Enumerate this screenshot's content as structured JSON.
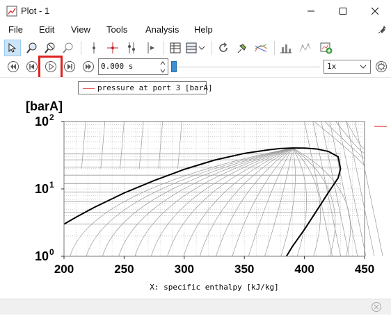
{
  "window": {
    "title": "Plot - 1"
  },
  "menu": [
    "File",
    "Edit",
    "View",
    "Tools",
    "Analysis",
    "Help"
  ],
  "toolbar": {
    "icons": [
      "pointer-icon",
      "zoom-icon",
      "zoom-out-icon",
      "zoom-reset-icon",
      "cursor-icon",
      "crosshair-icon",
      "cursors-icon",
      "cursor-step-icon",
      "table-icon",
      "refresh-icon",
      "pin-icon",
      "curves-icon",
      "bars-icon",
      "dots-icon",
      "add-plot-icon"
    ]
  },
  "playback": {
    "time": "0.000 s",
    "speed": "1x"
  },
  "legend": {
    "entry": "pressure at port 3 [barA]",
    "color": "#e46060"
  },
  "plot": {
    "y_unit": "[barA]",
    "y_ticks": [
      {
        "base": "10",
        "exp": "0"
      },
      {
        "base": "10",
        "exp": "1"
      },
      {
        "base": "10",
        "exp": "2"
      }
    ],
    "x_ticks": [
      "200",
      "250",
      "300",
      "350",
      "400",
      "450"
    ],
    "x_label": "X: specific enthalpy [kJ/kg]"
  },
  "chart_data": {
    "type": "line",
    "title": "",
    "xlabel": "X: specific enthalpy [kJ/kg]",
    "ylabel": "[barA]",
    "xlim": [
      200,
      450
    ],
    "ylim": [
      1,
      100
    ],
    "y_scale": "log",
    "grid": true,
    "series": [
      {
        "name": "",
        "role": "saturation dome",
        "color": "#000000",
        "x": [
          200,
          210,
          225,
          250,
          275,
          300,
          325,
          350,
          370,
          380,
          390,
          400,
          410,
          420,
          428,
          430,
          428,
          420,
          410,
          400,
          390,
          385
        ],
        "y": [
          3.0,
          3.8,
          5.3,
          8.7,
          13.3,
          19.5,
          26.7,
          33.7,
          38.0,
          39.8,
          40.5,
          40.3,
          39.2,
          36.0,
          30.0,
          20.0,
          14.5,
          8.9,
          4.7,
          2.5,
          1.4,
          1.0
        ]
      },
      {
        "name": "pressure at port 3 [barA]",
        "color": "#e46060",
        "x": [],
        "y": []
      }
    ]
  },
  "colors": {
    "accent": "#0078d4",
    "highlight": "#e02020",
    "series": "#e46060"
  }
}
